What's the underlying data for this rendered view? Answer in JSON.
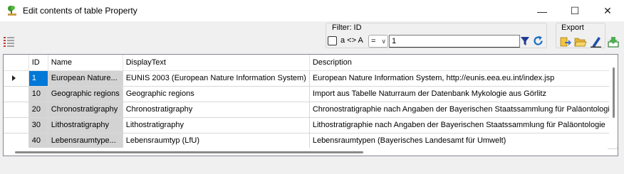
{
  "window": {
    "title": "Edit contents of table Property",
    "minimize_glyph": "—",
    "maximize_glyph": "☐",
    "close_glyph": "✕"
  },
  "filter": {
    "label": "Filter: ID",
    "case_label": "a <> A",
    "case_checked": false,
    "operator": "=",
    "value": "1"
  },
  "export": {
    "label": "Export"
  },
  "grid": {
    "columns": [
      "ID",
      "Name",
      "DisplayText",
      "Description"
    ],
    "selected_row": 0,
    "rows": [
      {
        "id": "1",
        "name": "European Nature...",
        "display": "EUNIS 2003 (European Nature Information System)",
        "description": "European Nature Information System, http://eunis.eea.eu.int/index.jsp"
      },
      {
        "id": "10",
        "name": "Geographic regions",
        "display": "Geographic regions",
        "description": "Import aus Tabelle Naturraum der Datenbank Mykologie aus Görlitz"
      },
      {
        "id": "20",
        "name": "Chronostratigraphy",
        "display": "Chronostratigraphy",
        "description": "Chronostratigraphie nach Angaben der Bayerischen Staatssammlung für Paläontologie"
      },
      {
        "id": "30",
        "name": "Lithostratigraphy",
        "display": "Lithostratigraphy",
        "description": "Lithostratigraphie nach Angaben der Bayerischen Staatssammlung für Paläontologie"
      },
      {
        "id": "40",
        "name": "Lebensraumtype...",
        "display": "Lebensraumtyp (LfU)",
        "description": "Lebensraumtypen (Bayerisches Landesamt für Umwelt)"
      }
    ]
  },
  "icons": {
    "app": "app-tree-icon",
    "row_header_toggle": "list-columns-icon",
    "filter": "filter-funnel-icon",
    "refresh": "refresh-icon",
    "export_1": "export-arrow-icon",
    "export_2": "open-folder-icon",
    "export_3": "edit-pen-icon",
    "export_4": "import-tray-icon"
  },
  "colors": {
    "selection": "#0078d7",
    "readonly_cell": "#d3d3d3",
    "filter_icon": "#1f3a93",
    "refresh_icon": "#1a6fc4"
  }
}
